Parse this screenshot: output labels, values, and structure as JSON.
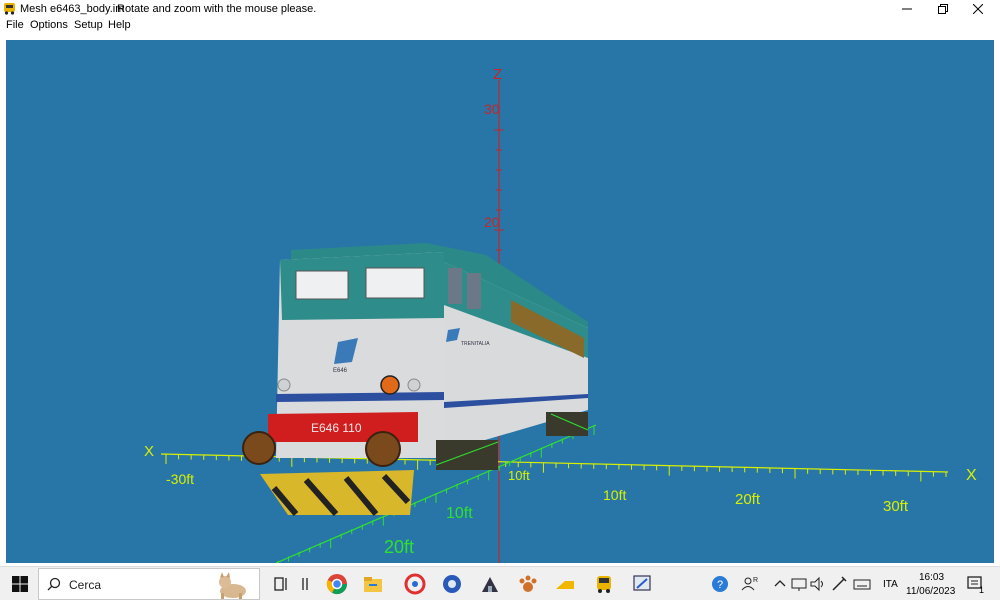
{
  "window": {
    "title": "Mesh e6463_body.im",
    "hint": "Rotate and zoom with the mouse please."
  },
  "menu": {
    "items": [
      "File",
      "Options",
      "Setup",
      "Help"
    ]
  },
  "viewport": {
    "background": "#2876a8",
    "axes": {
      "z_label": "Z",
      "x_label_left": "X",
      "x_label_right": "X",
      "z_ticks": [
        "30",
        "20"
      ],
      "x_ticks": [
        "-30ft",
        "10ft",
        "20ft",
        "30ft"
      ],
      "y_ticks": [
        "10ft",
        "20ft",
        "10ft"
      ]
    },
    "locomotive": {
      "front_number": "E646 110",
      "side_number": "E646",
      "brand": "TRENITALIA"
    }
  },
  "taskbar": {
    "search_placeholder": "Cerca",
    "language": "ITA",
    "time": "16:03",
    "date": "11/06/2023",
    "notification_count": "1"
  }
}
